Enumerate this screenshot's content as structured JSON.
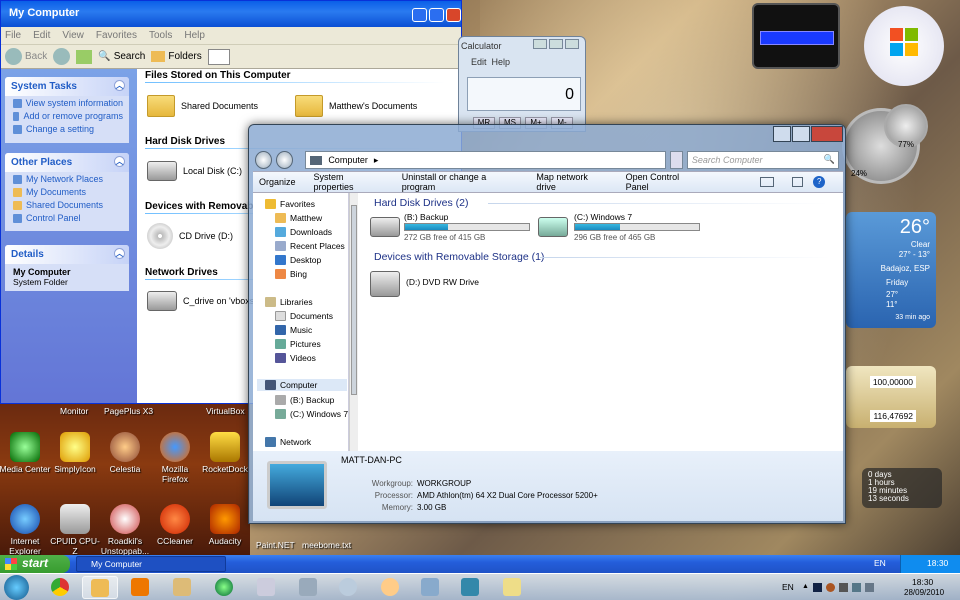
{
  "xp_window": {
    "title": "My Computer",
    "menu": [
      "File",
      "Edit",
      "View",
      "Favorites",
      "Tools",
      "Help"
    ],
    "toolbar": {
      "back": "Back",
      "search": "Search",
      "folders": "Folders"
    },
    "tasks": {
      "title": "System Tasks",
      "items": [
        "View system information",
        "Add or remove programs",
        "Change a setting"
      ]
    },
    "places": {
      "title": "Other Places",
      "items": [
        "My Network Places",
        "My Documents",
        "Shared Documents",
        "Control Panel"
      ]
    },
    "details": {
      "title": "Details",
      "name": "My Computer",
      "type": "System Folder"
    },
    "groups": {
      "files": "Files Stored on This Computer",
      "hdd": "Hard Disk Drives",
      "removable": "Devices with Removable St",
      "network": "Network Drives"
    },
    "items": {
      "shared": "Shared Documents",
      "matthew": "Matthew's Documents",
      "local": "Local Disk (C:)",
      "cd": "CD Drive (D:)",
      "net": "C_drive on 'vboxsvr'"
    }
  },
  "calculator": {
    "title": "Calculator",
    "menu": [
      "Edit",
      "Help"
    ],
    "display": "0",
    "mem": [
      "MR",
      "MS",
      "M+",
      "M-"
    ]
  },
  "explorer": {
    "breadcrumb": "Computer",
    "search_placeholder": "Search Computer",
    "commands": [
      "Organize",
      "System properties",
      "Uninstall or change a program",
      "Map network drive",
      "Open Control Panel"
    ],
    "nav": {
      "favorites": "Favorites",
      "fav_items": [
        "Matthew",
        "Downloads",
        "Recent Places",
        "Desktop",
        "Bing"
      ],
      "libraries": "Libraries",
      "lib_items": [
        "Documents",
        "Music",
        "Pictures",
        "Videos"
      ],
      "computer": "Computer",
      "comp_items": [
        "(B:) Backup",
        "(C:) Windows 7"
      ],
      "network": "Network"
    },
    "hdd_header": "Hard Disk Drives (2)",
    "drives": [
      {
        "name": "(B:) Backup",
        "free": "272 GB free of 415 GB",
        "used": 0.345
      },
      {
        "name": "(C:) Windows 7",
        "free": "296 GB free of 465 GB",
        "used": 0.363
      }
    ],
    "removable_header": "Devices with Removable Storage (1)",
    "dvd": "(D:) DVD RW Drive",
    "details": {
      "name": "MATT-DAN-PC",
      "workgroup_label": "Workgroup:",
      "workgroup": "WORKGROUP",
      "processor_label": "Processor:",
      "processor": "AMD Athlon(tm) 64 X2 Dual Core Processor 5200+",
      "memory_label": "Memory:",
      "memory": "3.00 GB"
    }
  },
  "desktop": {
    "top_labels": [
      "Monitor",
      "PagePlus X3",
      "VirtualBox"
    ],
    "icons_row1": [
      "Media Center",
      "SimplyIcon",
      "Celestia",
      "Mozilla Firefox",
      "RocketDock"
    ],
    "icons_row2": [
      "Internet Explorer",
      "CPUID CPU-Z",
      "Roadkil's Unstoppab...",
      "CCleaner",
      "Audacity"
    ],
    "files": [
      "Paint.NET",
      "meebome.txt"
    ]
  },
  "gadgets": {
    "cpu": "24%",
    "mem": "77%",
    "weather": {
      "temp": "26°",
      "cond": "Clear",
      "range": "27° - 13°",
      "city": "Badajoz, ESP",
      "f1": "Friday",
      "f1range": "27°",
      "f1low": "11°",
      "updated": "33 min ago"
    },
    "currency": [
      "100,00000",
      "116,47692"
    ],
    "countdown": [
      "0 days",
      "1 hours",
      "19 minutes",
      "13 seconds"
    ]
  },
  "xp_taskbar": {
    "start": "start",
    "task": "My Computer",
    "lang": "EN",
    "time": "18:30"
  },
  "w7_taskbar": {
    "lang": "EN",
    "time": "18:30",
    "date": "28/09/2010"
  }
}
